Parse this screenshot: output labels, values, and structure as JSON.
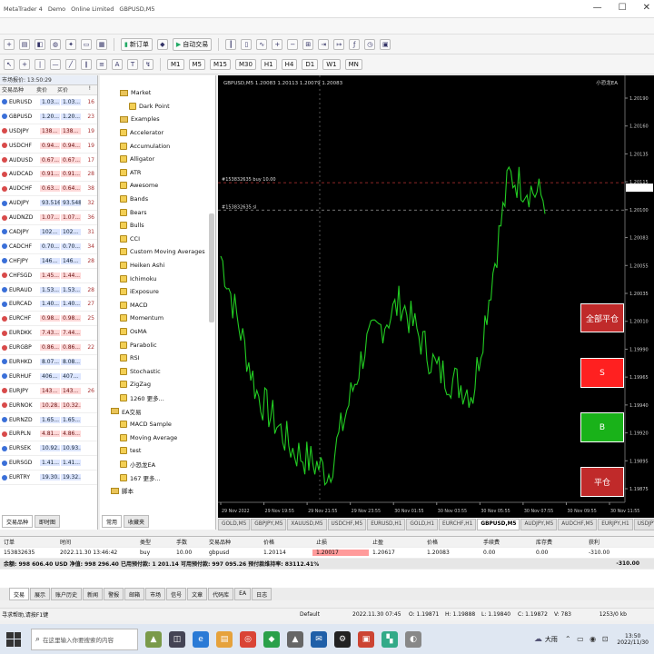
{
  "window": {
    "tabs": [
      "MetaTrader 4",
      "Demo",
      "Online Limited",
      "GBPUSD,M5"
    ],
    "min": "—",
    "max": "☐",
    "close": "✕"
  },
  "toolbar1": {
    "new_order": "新订单",
    "autotrade": "自动交易"
  },
  "market_watch": {
    "title": "市场报价: 13:50:29",
    "columns": [
      "交易品种",
      "卖价",
      "买价",
      "!"
    ],
    "rows": [
      {
        "sym": "EURUSD",
        "bid": "1.03...",
        "ask": "1.03...",
        "spr": "16",
        "dir": "up"
      },
      {
        "sym": "GBPUSD",
        "bid": "1.20...",
        "ask": "1.20...",
        "spr": "23",
        "dir": "up"
      },
      {
        "sym": "USDJPY",
        "bid": "138...",
        "ask": "138...",
        "spr": "19",
        "dir": "dn"
      },
      {
        "sym": "USDCHF",
        "bid": "0.94...",
        "ask": "0.94...",
        "spr": "19",
        "dir": "dn"
      },
      {
        "sym": "AUDUSD",
        "bid": "0.67...",
        "ask": "0.67...",
        "spr": "17",
        "dir": "dn"
      },
      {
        "sym": "AUDCAD",
        "bid": "0.91...",
        "ask": "0.91...",
        "spr": "28",
        "dir": "dn"
      },
      {
        "sym": "AUDCHF",
        "bid": "0.63...",
        "ask": "0.64...",
        "spr": "38",
        "dir": "dn"
      },
      {
        "sym": "AUDJPY",
        "bid": "93.516",
        "ask": "93.548",
        "spr": "32",
        "dir": "up"
      },
      {
        "sym": "AUDNZD",
        "bid": "1.07...",
        "ask": "1.07...",
        "spr": "36",
        "dir": "dn"
      },
      {
        "sym": "CADJPY",
        "bid": "102...",
        "ask": "102...",
        "spr": "31",
        "dir": "up"
      },
      {
        "sym": "CADCHF",
        "bid": "0.70...",
        "ask": "0.70...",
        "spr": "34",
        "dir": "up"
      },
      {
        "sym": "CHFJPY",
        "bid": "146...",
        "ask": "146...",
        "spr": "28",
        "dir": "up"
      },
      {
        "sym": "CHFSGD",
        "bid": "1.45...",
        "ask": "1.44...",
        "spr": "",
        "dir": "dn"
      },
      {
        "sym": "EURAUD",
        "bid": "1.53...",
        "ask": "1.53...",
        "spr": "28",
        "dir": "up"
      },
      {
        "sym": "EURCAD",
        "bid": "1.40...",
        "ask": "1.40...",
        "spr": "27",
        "dir": "up"
      },
      {
        "sym": "EURCHF",
        "bid": "0.98...",
        "ask": "0.98...",
        "spr": "25",
        "dir": "dn"
      },
      {
        "sym": "EURDKK",
        "bid": "7.43...",
        "ask": "7.44...",
        "spr": "",
        "dir": "dn"
      },
      {
        "sym": "EURGBP",
        "bid": "0.86...",
        "ask": "0.86...",
        "spr": "22",
        "dir": "dn"
      },
      {
        "sym": "EURHKD",
        "bid": "8.07...",
        "ask": "8.08...",
        "spr": "",
        "dir": "up"
      },
      {
        "sym": "EURHUF",
        "bid": "406...",
        "ask": "407...",
        "spr": "",
        "dir": "up"
      },
      {
        "sym": "EURJPY",
        "bid": "143...",
        "ask": "143...",
        "spr": "26",
        "dir": "dn"
      },
      {
        "sym": "EURNOK",
        "bid": "10.28...",
        "ask": "10.32...",
        "spr": "",
        "dir": "dn"
      },
      {
        "sym": "EURNZD",
        "bid": "1.65...",
        "ask": "1.65...",
        "spr": "",
        "dir": "up"
      },
      {
        "sym": "EURPLN",
        "bid": "4.81...",
        "ask": "4.86...",
        "spr": "",
        "dir": "dn"
      },
      {
        "sym": "EURSEK",
        "bid": "10.92...",
        "ask": "10.93...",
        "spr": "",
        "dir": "up"
      },
      {
        "sym": "EURSGD",
        "bid": "1.41...",
        "ask": "1.41...",
        "spr": "",
        "dir": "up"
      },
      {
        "sym": "EURTRY",
        "bid": "19.30...",
        "ask": "19.32...",
        "spr": "",
        "dir": "up"
      }
    ],
    "tabs": [
      "交易品种",
      "即时图"
    ]
  },
  "navigator": {
    "items": [
      {
        "label": "Market",
        "kind": "folder",
        "indent": 1
      },
      {
        "label": "Dark Point",
        "kind": "ind",
        "indent": 2
      },
      {
        "label": "Examples",
        "kind": "folder",
        "indent": 1
      },
      {
        "label": "Accelerator",
        "kind": "ind",
        "indent": 1
      },
      {
        "label": "Accumulation",
        "kind": "ind",
        "indent": 1
      },
      {
        "label": "Alligator",
        "kind": "ind",
        "indent": 1
      },
      {
        "label": "ATR",
        "kind": "ind",
        "indent": 1
      },
      {
        "label": "Awesome",
        "kind": "ind",
        "indent": 1
      },
      {
        "label": "Bands",
        "kind": "ind",
        "indent": 1
      },
      {
        "label": "Bears",
        "kind": "ind",
        "indent": 1
      },
      {
        "label": "Bulls",
        "kind": "ind",
        "indent": 1
      },
      {
        "label": "CCI",
        "kind": "ind",
        "indent": 1
      },
      {
        "label": "Custom Moving Averages",
        "kind": "ind",
        "indent": 1
      },
      {
        "label": "Heiken Ashi",
        "kind": "ind",
        "indent": 1
      },
      {
        "label": "Ichimoku",
        "kind": "ind",
        "indent": 1
      },
      {
        "label": "iExposure",
        "kind": "ind",
        "indent": 1
      },
      {
        "label": "MACD",
        "kind": "ind",
        "indent": 1
      },
      {
        "label": "Momentum",
        "kind": "ind",
        "indent": 1
      },
      {
        "label": "OsMA",
        "kind": "ind",
        "indent": 1
      },
      {
        "label": "Parabolic",
        "kind": "ind",
        "indent": 1
      },
      {
        "label": "RSI",
        "kind": "ind",
        "indent": 1
      },
      {
        "label": "Stochastic",
        "kind": "ind",
        "indent": 1
      },
      {
        "label": "ZigZag",
        "kind": "ind",
        "indent": 1
      },
      {
        "label": "1260 更多...",
        "kind": "ind",
        "indent": 1
      },
      {
        "label": "EA交易",
        "kind": "folder",
        "indent": 0
      },
      {
        "label": "MACD Sample",
        "kind": "ind",
        "indent": 1
      },
      {
        "label": "Moving Average",
        "kind": "ind",
        "indent": 1
      },
      {
        "label": "test",
        "kind": "ind",
        "indent": 1
      },
      {
        "label": "小恐龙EA",
        "kind": "ind",
        "indent": 1
      },
      {
        "label": "167 更多...",
        "kind": "ind",
        "indent": 1
      },
      {
        "label": "脚本",
        "kind": "folder",
        "indent": 0
      }
    ],
    "tabs": [
      "常用",
      "收藏夹"
    ]
  },
  "chart": {
    "header": "GBPUSD,M5 1.20083 1.20113 1.20079 1.20083",
    "corner": "小恐龙EA",
    "lines": [
      {
        "label": "#153832635 tp",
        "price": 1.2055
      },
      {
        "label": "#153832635 buy 10.00",
        "price": 1.20114
      },
      {
        "label": "#153832635 sl",
        "price": 1.2009
      }
    ],
    "price_axis": [
      "1.20190",
      "1.20160",
      "1.20135",
      "1.20115",
      "1.20100",
      "1.20083",
      "1.20055",
      "1.20035",
      "1.20010",
      "1.19990",
      "1.19965",
      "1.19940",
      "1.19920",
      "1.19895",
      "1.19875"
    ],
    "time_axis": [
      "29 Nov 2022",
      "29 Nov 19:55",
      "29 Nov 21:55",
      "29 Nov 23:55",
      "30 Nov 01:55",
      "30 Nov 03:55",
      "30 Nov 05:55",
      "30 Nov 07:55",
      "30 Nov 09:55",
      "30 Nov 11:55"
    ],
    "buttons": {
      "close_all": "全部平仓",
      "sell": "S",
      "buy": "B",
      "flat": "平仓"
    },
    "colors": {
      "bg": "#000000",
      "line": "#22cc22",
      "sell": "#ff2020",
      "buy": "#19b219",
      "close_all": "#c02a2a",
      "flat": "#c02a2a"
    }
  },
  "chart_data": {
    "type": "line",
    "x": [
      "29 Nov 2022",
      "29 Nov 19:55",
      "29 Nov 21:55",
      "29 Nov 23:55",
      "30 Nov 01:55",
      "30 Nov 03:55",
      "30 Nov 05:55",
      "30 Nov 07:55",
      "30 Nov 09:55",
      "30 Nov 11:55"
    ],
    "series": [
      {
        "name": "GBPUSD,M5",
        "values": [
          1.2005,
          1.1993,
          1.1988,
          1.1986,
          1.1997,
          1.2001,
          1.1995,
          1.1993,
          1.2012,
          1.201
        ]
      }
    ],
    "ylim": [
      1.1985,
      1.202
    ],
    "grid": false
  },
  "chart_tabs": [
    "GOLD,M5",
    "GBPJPY,M5",
    "XAUUSD,M5",
    "USDCHF,M5",
    "EURUSD,H1",
    "GOLD,H1",
    "EURCHF,H1",
    "GBPUSD,M5",
    "AUDJPY,M5",
    "AUDCHF,M5",
    "EURJPY,H1",
    "USDJPY,M5"
  ],
  "chart_tabs_active": 7,
  "terminal": {
    "columns": [
      "订单",
      "时间",
      "类型",
      "手数",
      "交易品种",
      "价格",
      "止损",
      "止盈",
      "价格",
      "手续费",
      "库存费",
      "获利"
    ],
    "order": [
      "153832635",
      "2022.11.30 13:46:42",
      "buy",
      "10.00",
      "gbpusd",
      "1.20114",
      "1.20017",
      "1.20617",
      "1.20083",
      "0.00",
      "0.00",
      "-310.00"
    ],
    "total": "余额: 998 606.40 USD  净值: 998 296.40  已用预付款: 1 201.14  可用预付款: 997 095.26  预付款维持率: 83112.41%",
    "total_profit": "-310.00",
    "tabs": [
      "交易",
      "展示",
      "账户历史",
      "新闻",
      "警报",
      "邮箱",
      "市场",
      "信号",
      "文章",
      "代码库",
      "EA",
      "日志"
    ]
  },
  "statusbar": {
    "help": "寻求帮助,请按F1键",
    "default": "Default",
    "time": "2022.11.30 07:45",
    "o": "O: 1.19871",
    "h": "H: 1.19888",
    "l": "L: 1.19840",
    "c": "C: 1.19872",
    "v": "V: 783",
    "traffic": "1253/0 kb"
  },
  "taskbar": {
    "search": "在这里输入你要搜索的内容",
    "weather": "大雨",
    "clock_time": "13:50",
    "clock_date": "2022/11/30"
  }
}
